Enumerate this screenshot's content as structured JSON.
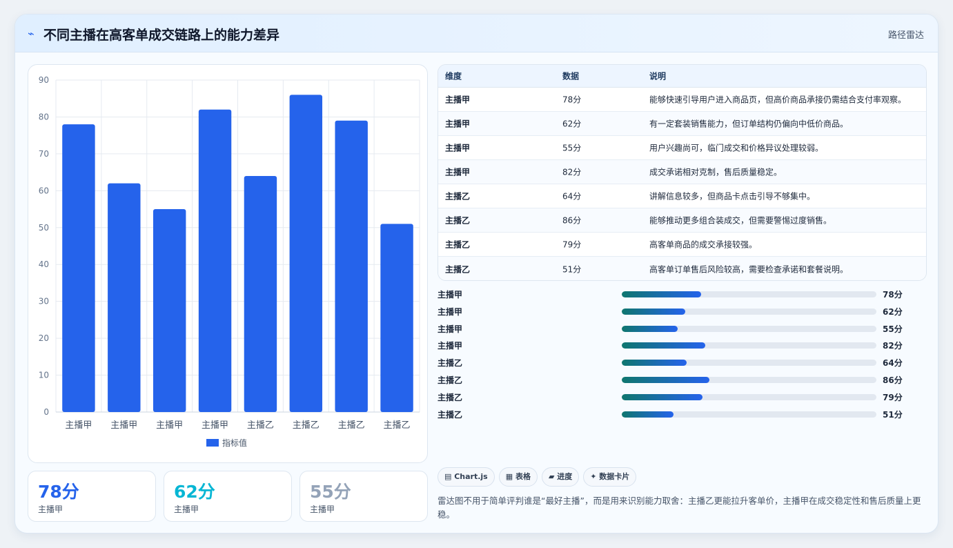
{
  "header": {
    "icon": "⌁",
    "title": "不同主播在高客单成交链路上的能力差异",
    "tag": "路径雷达"
  },
  "chart_data": {
    "type": "bar",
    "categories": [
      "主播甲",
      "主播甲",
      "主播甲",
      "主播甲",
      "主播乙",
      "主播乙",
      "主播乙",
      "主播乙"
    ],
    "series": [
      {
        "name": "指标值",
        "values": [
          78,
          62,
          55,
          82,
          64,
          86,
          79,
          51
        ]
      }
    ],
    "ylim": [
      0,
      90
    ],
    "yticks": [
      0,
      10,
      20,
      30,
      40,
      50,
      60,
      70,
      80,
      90
    ],
    "grid": true,
    "legend": "bottom",
    "color": "#2563eb"
  },
  "stats": [
    {
      "value": "78分",
      "label": "主播甲",
      "color": "#2563eb"
    },
    {
      "value": "62分",
      "label": "主播甲",
      "color": "#06b6d4"
    },
    {
      "value": "55分",
      "label": "主播甲",
      "color": "#94a3b8"
    }
  ],
  "table": {
    "headers": [
      "维度",
      "数据",
      "说明"
    ],
    "rows": [
      [
        "主播甲",
        "78分",
        "能够快速引导用户进入商品页，但高价商品承接仍需结合支付率观察。"
      ],
      [
        "主播甲",
        "62分",
        "有一定套装销售能力，但订单结构仍偏向中低价商品。"
      ],
      [
        "主播甲",
        "55分",
        "用户兴趣尚可，临门成交和价格异议处理较弱。"
      ],
      [
        "主播甲",
        "82分",
        "成交承诺相对克制，售后质量稳定。"
      ],
      [
        "主播乙",
        "64分",
        "讲解信息较多，但商品卡点击引导不够集中。"
      ],
      [
        "主播乙",
        "86分",
        "能够推动更多组合装成交，但需要警惕过度销售。"
      ],
      [
        "主播乙",
        "79分",
        "高客单商品的成交承接较强。"
      ],
      [
        "主播乙",
        "51分",
        "高客单订单售后风险较高，需要检查承诺和套餐说明。"
      ]
    ]
  },
  "progress": [
    {
      "label": "主播甲",
      "value": 78,
      "text": "78分"
    },
    {
      "label": "主播甲",
      "value": 62,
      "text": "62分"
    },
    {
      "label": "主播甲",
      "value": 55,
      "text": "55分"
    },
    {
      "label": "主播甲",
      "value": 82,
      "text": "82分"
    },
    {
      "label": "主播乙",
      "value": 64,
      "text": "64分"
    },
    {
      "label": "主播乙",
      "value": 86,
      "text": "86分"
    },
    {
      "label": "主播乙",
      "value": 79,
      "text": "79分"
    },
    {
      "label": "主播乙",
      "value": 51,
      "text": "51分"
    }
  ],
  "progress_max": 250,
  "chips": [
    "▤ Chart.js",
    "▦ 表格",
    "▰ 进度",
    "✦ 数据卡片"
  ],
  "note": "雷达图不用于简单评判谁是“最好主播”，而是用来识别能力取舍：主播乙更能拉升客单价，主播甲在成交稳定性和售后质量上更稳。"
}
